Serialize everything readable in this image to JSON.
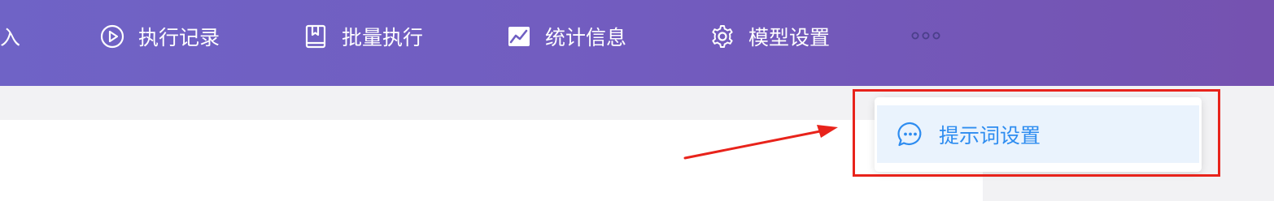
{
  "nav": {
    "partial_item": "导入",
    "items": [
      {
        "label": "执行记录",
        "icon": "play-circle-icon"
      },
      {
        "label": "批量执行",
        "icon": "book-icon"
      },
      {
        "label": "统计信息",
        "icon": "chart-icon"
      },
      {
        "label": "模型设置",
        "icon": "gear-icon"
      }
    ],
    "more_icon": "more-dots-icon"
  },
  "dropdown": {
    "items": [
      {
        "label": "提示词设置",
        "icon": "chat-bubble-icon"
      }
    ]
  },
  "colors": {
    "nav_gradient_start": "#6f63c6",
    "nav_gradient_end": "#7552b0",
    "dropdown_active_bg": "#eaf3fd",
    "dropdown_text": "#2d8cf0",
    "annotation_red": "#e8231b"
  }
}
